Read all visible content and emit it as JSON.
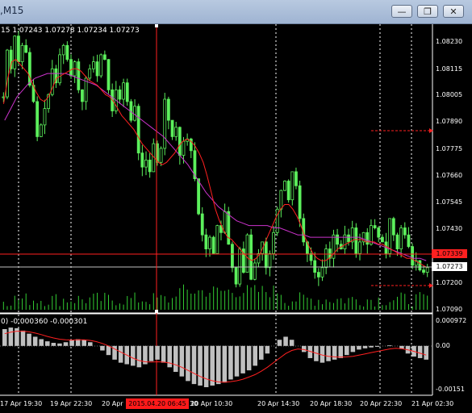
{
  "window": {
    "title": ",M15",
    "buttons": [
      "minimize",
      "restore",
      "close"
    ]
  },
  "chart_header": {
    "ohlc_text": "15  1.07243 1.07278 1.07234 1.07273"
  },
  "macd_header": {
    "text": "0) -0.000360 -0.000301"
  },
  "price_axis": {
    "ticks": [
      "1.08230",
      "1.08115",
      "1.08005",
      "1.07890",
      "1.07775",
      "1.07660",
      "1.07545",
      "1.07430",
      "1.07200",
      "1.07090"
    ],
    "current_price": "1.07273",
    "crosshair_price": "1.07339"
  },
  "macd_axis": {
    "ticks": [
      "0.000972",
      "0.00",
      "-0.00151"
    ]
  },
  "time_axis": {
    "ticks": [
      "17 Apr 19:30",
      "19 Apr 22:30",
      "20 Apr",
      "20 Apr 10:30",
      "20 Apr 14:30",
      "20 Apr 18:30",
      "20 Apr 22:30",
      "21 Apr 02:30"
    ],
    "cursor_time": "2015.04.20 06:45",
    "cursor_suffix": "30"
  },
  "colors": {
    "candle": "#5cf05c",
    "volume": "#33cc33",
    "ma_fast": "#ff2020",
    "ma_slow": "#cc33cc",
    "macd_hist": "#c0c0c0",
    "signal": "#ff2020",
    "crosshair": "#ff2020",
    "grid": "#ffffff"
  },
  "chart_data": {
    "type": "candlestick",
    "ylim": [
      1.0709,
      1.0829
    ],
    "close": [
      1.08,
      1.082,
      1.0812,
      1.0826,
      1.0815,
      1.0822,
      1.0819,
      1.0805,
      1.0798,
      1.0783,
      1.0788,
      1.0795,
      1.0801,
      1.0812,
      1.0806,
      1.0818,
      1.0822,
      1.0816,
      1.0809,
      1.0815,
      1.0803,
      1.0798,
      1.0808,
      1.0812,
      1.0815,
      1.0809,
      1.0818,
      1.0816,
      1.0803,
      1.0794,
      1.0803,
      1.0799,
      1.0806,
      1.0798,
      1.079,
      1.0796,
      1.0776,
      1.077,
      1.0773,
      1.0768,
      1.078,
      1.0772,
      1.0778,
      1.0799,
      1.079,
      1.0783,
      1.0787,
      1.0775,
      1.0781,
      1.0782,
      1.0777,
      1.0765,
      1.075,
      1.0741,
      1.0735,
      1.074,
      1.0733,
      1.0745,
      1.0742,
      1.0751,
      1.0737,
      1.0727,
      1.072,
      1.0735,
      1.0725,
      1.0741,
      1.0722,
      1.0729,
      1.0733,
      1.0738,
      1.0727,
      1.0733,
      1.0742,
      1.0752,
      1.076,
      1.0764,
      1.0756,
      1.0768,
      1.0762,
      1.0748,
      1.0738,
      1.0733,
      1.073,
      1.0725,
      1.0723,
      1.0727,
      1.0735,
      1.0731,
      1.0741,
      1.0737,
      1.0735,
      1.0741,
      1.0738,
      1.0744,
      1.0733,
      1.0738,
      1.0742,
      1.0737,
      1.0745,
      1.0744,
      1.074,
      1.0738,
      1.0733,
      1.0748,
      1.0741,
      1.0735,
      1.0744,
      1.0741,
      1.0736,
      1.0728,
      1.073,
      1.0726,
      1.0725,
      1.0727
    ],
    "ma_fast": [
      1.0797,
      1.0808,
      1.0815,
      1.0816,
      1.0814,
      1.0812,
      1.081,
      1.0806,
      1.0802,
      1.0799,
      1.0798,
      1.08,
      1.0804,
      1.0808,
      1.0809,
      1.081,
      1.0811,
      1.0812,
      1.0812,
      1.0811,
      1.0809,
      1.0807,
      1.0806,
      1.0805,
      1.0803,
      1.0801,
      1.08,
      1.0798,
      1.0795,
      1.0792,
      1.079,
      1.0788,
      1.0786,
      1.0783,
      1.078,
      1.0778,
      1.0776,
      1.0774,
      1.0772,
      1.0771,
      1.0772,
      1.0774,
      1.0776,
      1.0779,
      1.0781,
      1.0782,
      1.0781,
      1.0779,
      1.0776,
      1.0772,
      1.0766,
      1.0759,
      1.0752,
      1.0747,
      1.0743,
      1.074,
      1.0739,
      1.0737,
      1.0735,
      1.0733,
      1.0731,
      1.073,
      1.0731,
      1.0733,
      1.0737,
      1.0741,
      1.0745,
      1.0749,
      1.0752,
      1.0754,
      1.0754,
      1.0752,
      1.0749,
      1.0745,
      1.074,
      1.0736,
      1.0733,
      1.0731,
      1.073,
      1.073,
      1.0731,
      1.0733,
      1.0735,
      1.0736,
      1.0737,
      1.0738,
      1.0739,
      1.0739,
      1.0739,
      1.0738,
      1.0738,
      1.0738,
      1.0737,
      1.0737,
      1.0736,
      1.0735,
      1.0734,
      1.0733,
      1.0732,
      1.0731,
      1.0731,
      1.073,
      1.0729,
      1.0728,
      1.0727
    ],
    "ma_slow": [
      1.079,
      1.0795,
      1.08,
      1.0803,
      1.0806,
      1.0808,
      1.0809,
      1.081,
      1.081,
      1.081,
      1.081,
      1.0809,
      1.0808,
      1.0807,
      1.0806,
      1.0805,
      1.0803,
      1.0801,
      1.0799,
      1.0797,
      1.0795,
      1.0793,
      1.0791,
      1.0789,
      1.0787,
      1.0785,
      1.0783,
      1.078,
      1.0777,
      1.0774,
      1.0771,
      1.0767,
      1.0763,
      1.0759,
      1.0756,
      1.0753,
      1.0751,
      1.0749,
      1.0747,
      1.0746,
      1.0745,
      1.0745,
      1.0745,
      1.0745,
      1.0744,
      1.0744,
      1.0743,
      1.0742,
      1.0741,
      1.0741,
      1.074,
      1.074,
      1.074,
      1.074,
      1.074,
      1.074,
      1.074,
      1.074,
      1.074,
      1.0739,
      1.0738,
      1.0737,
      1.0736,
      1.0735,
      1.0734,
      1.0733,
      1.0732,
      1.0731,
      1.0731,
      1.073
    ],
    "macd_hist": [
      0.00055,
      0.0006,
      0.00058,
      0.0005,
      0.0004,
      0.0003,
      0.00022,
      0.00015,
      0.0001,
      8e-05,
      0.00012,
      0.00018,
      0.00022,
      0.0002,
      0.00012,
      0.0,
      -0.00015,
      -0.0003,
      -0.00045,
      -0.00055,
      -0.0006,
      -0.00065,
      -0.0007,
      -0.0006,
      -0.0005,
      -0.00045,
      -0.00055,
      -0.0007,
      -0.00085,
      -0.001,
      -0.00115,
      -0.00125,
      -0.0013,
      -0.00135,
      -0.0013,
      -0.00125,
      -0.0012,
      -0.0011,
      -0.001,
      -0.0009,
      -0.0008,
      -0.00065,
      -0.00045,
      -0.00025,
      0.0,
      0.0002,
      0.0003,
      0.0002,
      0.0,
      -0.0002,
      -0.0004,
      -0.0005,
      -0.00055,
      -0.0005,
      -0.00045,
      -0.0004,
      -0.0003,
      -0.0002,
      -0.00012,
      -8e-05,
      -5e-05,
      -3e-05,
      0.0,
      2e-05,
      0.0,
      -0.0001,
      -0.00025,
      -0.00035,
      -0.0004,
      -0.00045
    ],
    "macd_signal": [
      0.0004,
      0.00045,
      0.00048,
      0.00048,
      0.00046,
      0.00042,
      0.00037,
      0.00031,
      0.00026,
      0.00022,
      0.0002,
      0.00019,
      0.0002,
      0.0002,
      0.00018,
      0.00014,
      8e-05,
      0.0,
      -0.0001,
      -0.0002,
      -0.0003,
      -0.0004,
      -0.00048,
      -0.00052,
      -0.00053,
      -0.00052,
      -0.00053,
      -0.00056,
      -0.00062,
      -0.0007,
      -0.0008,
      -0.0009,
      -0.001,
      -0.00108,
      -0.00114,
      -0.00118,
      -0.00119,
      -0.00117,
      -0.00114,
      -0.00109,
      -0.00102,
      -0.00094,
      -0.00083,
      -0.0007,
      -0.00055,
      -0.0004,
      -0.00025,
      -0.00015,
      -0.0001,
      -0.00012,
      -0.00018,
      -0.00024,
      -0.0003,
      -0.00034,
      -0.00036,
      -0.00037,
      -0.00036,
      -0.00034,
      -0.0003,
      -0.00026,
      -0.00022,
      -0.00018,
      -0.00014,
      -0.0001,
      -8e-05,
      -9e-05,
      -0.00013,
      -0.00018,
      -0.00024,
      -0.0003
    ],
    "macd_ylim": [
      -0.00151,
      0.000972
    ]
  }
}
